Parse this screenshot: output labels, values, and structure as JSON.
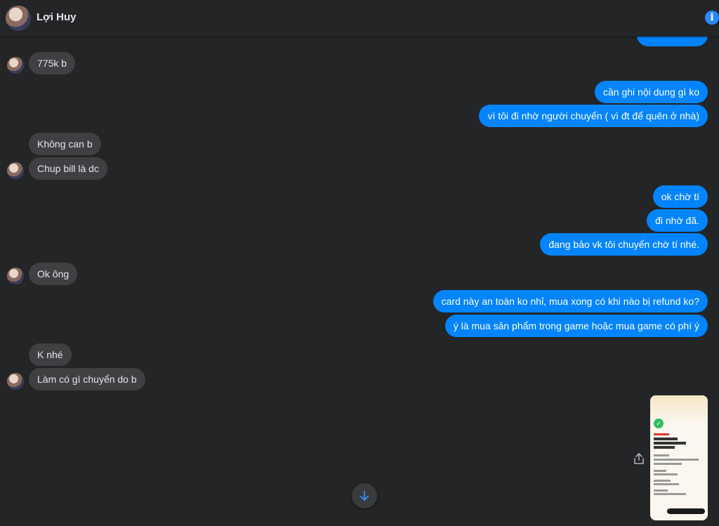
{
  "header": {
    "contact_name": "Lợi Huy",
    "info_icon": "info-icon",
    "info_glyph": "i",
    "accent_color": "#0084ff"
  },
  "messages": {
    "m1": "775k b",
    "m2": "cần ghi nội dung gì ko",
    "m3": "vì tôi đi nhờ người chuyển ( vì đt để quên ở nhà)",
    "m4": "Không can b",
    "m5": "Chup bill là dc",
    "m6": "ok chờ tí",
    "m7": "đi nhờ đã.",
    "m8": "đang bảo vk tôi chuyển chờ tí nhé.",
    "m9": "Ok ông",
    "m10": "card này an toàn ko nhỉ, mua xong có khi nào bị refund ko?",
    "m11": "ý là mua sản phẩm trong game hoặc mua game có phí ý",
    "m12": "K nhé",
    "m13": "Làm có gì chuyển do b"
  },
  "attachment": {
    "type": "image",
    "description_icon": "transfer-receipt-image",
    "check_glyph": "✓"
  },
  "icons": {
    "share": "share-icon",
    "scroll_down": "arrow-down-icon"
  },
  "colors": {
    "background": "#242526",
    "incoming_bubble": "#3e4042",
    "outgoing_bubble": "#0084ff",
    "info": "#2d88ff"
  }
}
